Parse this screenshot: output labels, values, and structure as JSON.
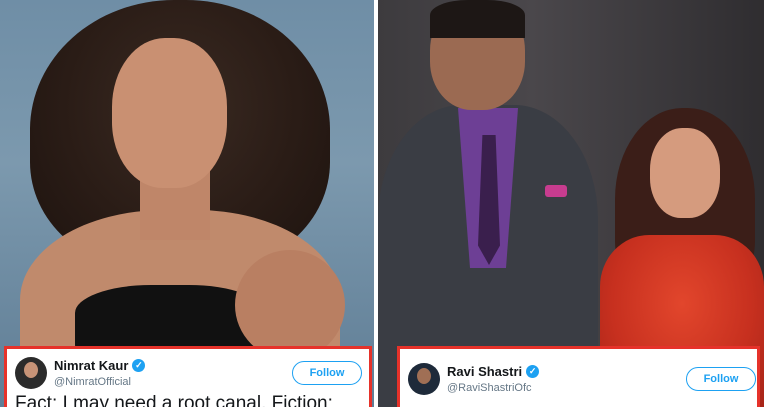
{
  "left_tweet": {
    "name": "Nimrat Kaur",
    "handle": "@NimratOfficial",
    "follow_label": "Follow",
    "text": "Fact: I may need a root canal. Fiction:"
  },
  "right_tweet": {
    "name": "Ravi Shastri",
    "handle": "@RaviShastriOfc",
    "follow_label": "Follow"
  },
  "icons": {
    "verified": "verified-checkmark-icon"
  },
  "colors": {
    "highlight_border": "#e6322a",
    "twitter_blue": "#1da1f2"
  }
}
